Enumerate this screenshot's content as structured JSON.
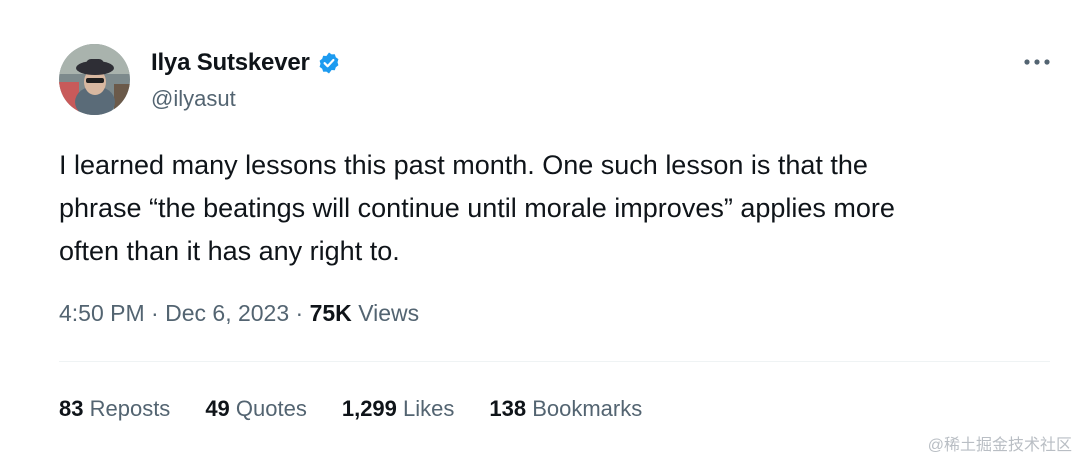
{
  "author": {
    "display_name": "Ilya Sutskever",
    "handle": "@ilyasut",
    "verified": true
  },
  "tweet": {
    "lines": [
      "I learned many lessons this past month. One such lesson is that the",
      "phrase “the beatings will continue until morale improves” applies more",
      "often than it has any right to."
    ]
  },
  "meta": {
    "time": "4:50 PM",
    "separator": "·",
    "date": "Dec 6, 2023",
    "views_count": "75K",
    "views_label": "Views"
  },
  "stats": [
    {
      "count": "83",
      "label": "Reposts"
    },
    {
      "count": "49",
      "label": "Quotes"
    },
    {
      "count": "1,299",
      "label": "Likes"
    },
    {
      "count": "138",
      "label": "Bookmarks"
    }
  ],
  "watermark": "@稀土掘金技术社区",
  "colors": {
    "verified": "#1d9bf0",
    "text_primary": "#0f1419",
    "text_secondary": "#536471"
  },
  "icons": {
    "verified": "verified-badge-icon",
    "more": "more-horizontal-icon"
  }
}
